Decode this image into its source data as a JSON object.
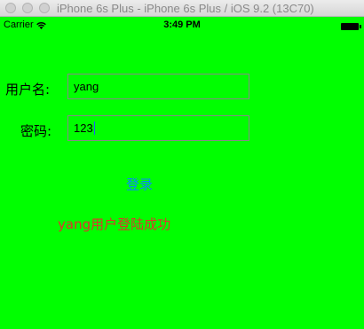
{
  "window": {
    "title": "iPhone 6s Plus - iPhone 6s Plus / iOS 9.2 (13C70)"
  },
  "status_bar": {
    "carrier": "Carrier",
    "time": "3:49 PM"
  },
  "form": {
    "username_label": "用户名:",
    "username_value": "yang",
    "password_label": "密码:",
    "password_value": "123",
    "login_label": "登录"
  },
  "result": {
    "message": "yang用户登陆成功"
  },
  "colors": {
    "background": "#00ff00",
    "login_text": "#0a84ff",
    "result_text": "#e0332b"
  }
}
